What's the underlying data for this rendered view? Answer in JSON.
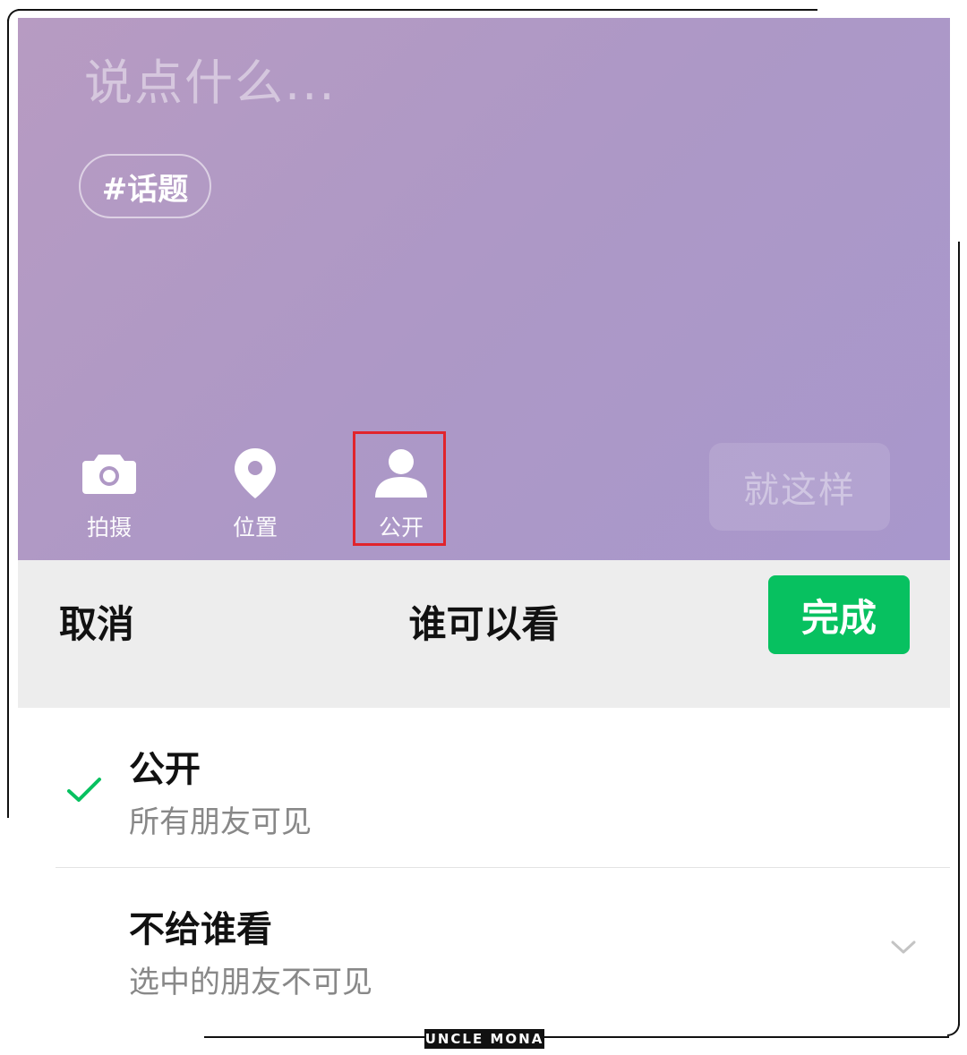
{
  "composer": {
    "placeholder": "说点什么...",
    "topic_chip": "#话题",
    "tools": [
      {
        "icon": "camera-icon",
        "label": "拍摄"
      },
      {
        "icon": "location-pin-icon",
        "label": "位置"
      },
      {
        "icon": "person-icon",
        "label": "公开"
      }
    ],
    "post_button": "就这样",
    "background_colors": [
      "#b79bc2",
      "#a897cc"
    ],
    "highlight_color": "#e1242c"
  },
  "visibility_panel": {
    "cancel_label": "取消",
    "title": "谁可以看",
    "done_label": "完成",
    "done_color": "#07c160",
    "options": [
      {
        "title": "公开",
        "subtitle": "所有朋友可见",
        "selected": true,
        "icon": "check-icon"
      },
      {
        "title": "不给谁看",
        "subtitle": "选中的朋友不可见",
        "selected": false,
        "icon": "chevron-down-icon"
      }
    ]
  },
  "watermark": "UNCLE MONA"
}
